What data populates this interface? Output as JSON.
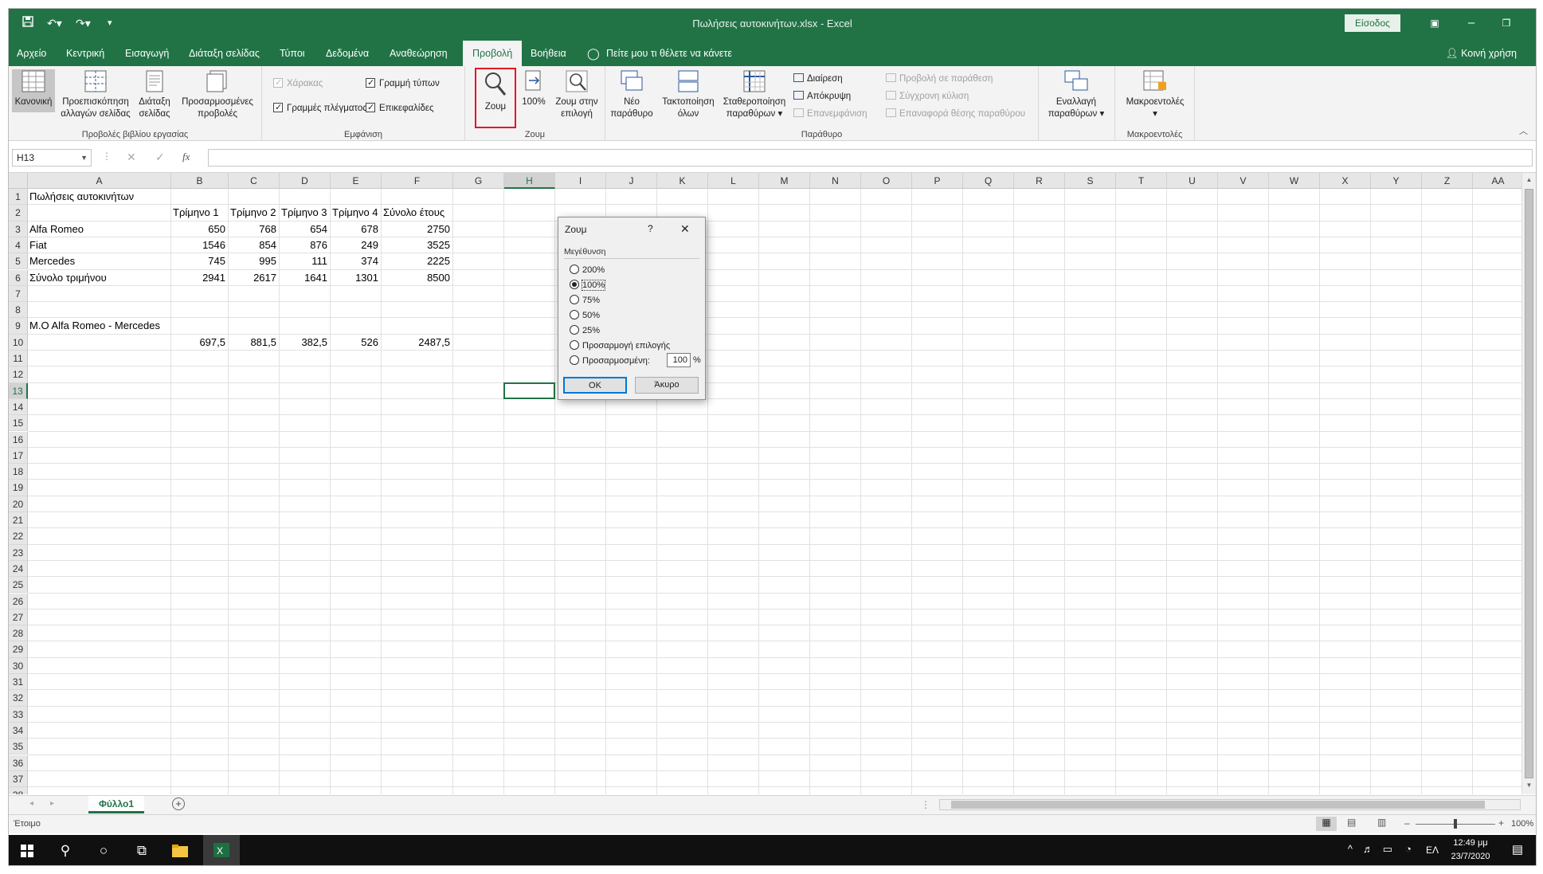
{
  "window": {
    "title": "Πωλήσεις αυτοκινήτων.xlsx  -  Excel",
    "signin_label": "Είσοδος",
    "qat_icons": [
      "save-icon",
      "undo-icon",
      "redo-icon",
      "customize-icon"
    ]
  },
  "tabs": [
    "Αρχείο",
    "Κεντρική",
    "Εισαγωγή",
    "Διάταξη σελίδας",
    "Τύποι",
    "Δεδομένα",
    "Αναθεώρηση",
    "Προβολή",
    "Βοήθεια"
  ],
  "active_tab": "Προβολή",
  "tell_me": "Πείτε μου τι θέλετε να κάνετε",
  "share_label": "Κοινή χρήση",
  "ribbon": {
    "views_group": {
      "label": "Προβολές βιβλίου εργασίας",
      "normal": "Κανονική",
      "page_break_1": "Προεπισκόπηση",
      "page_break_2": "αλλαγών σελίδας",
      "page_layout_1": "Διάταξη",
      "page_layout_2": "σελίδας",
      "custom_1": "Προσαρμοσμένες",
      "custom_2": "προβολές"
    },
    "show_group": {
      "label": "Εμφάνιση",
      "ruler": "Χάρακας",
      "formula_bar": "Γραμμή τύπων",
      "gridlines": "Γραμμές πλέγματος",
      "headings": "Επικεφαλίδες"
    },
    "zoom_group": {
      "label": "Ζουμ",
      "zoom": "Ζουμ",
      "hundred": "100%",
      "zoom_sel_1": "Ζουμ στην",
      "zoom_sel_2": "επιλογή"
    },
    "window_group": {
      "label": "Παράθυρο",
      "new_window_1": "Νέο",
      "new_window_2": "παράθυρο",
      "arrange_1": "Τακτοποίηση",
      "arrange_2": "όλων",
      "freeze_1": "Σταθεροποίηση",
      "freeze_2": "παραθύρων ▾",
      "split": "Διαίρεση",
      "hide": "Απόκρυψη",
      "unhide": "Επανεμφάνιση",
      "side_by_side": "Προβολή σε παράθεση",
      "sync_scroll": "Σύγχρονη κύλιση",
      "reset_pos": "Επαναφορά θέσης παραθύρου",
      "switch_1": "Εναλλαγή",
      "switch_2": "παραθύρων ▾"
    },
    "macros_group": {
      "label": "Μακροεντολές",
      "macros_1": "Μακροεντολές",
      "macros_2": "▾"
    }
  },
  "formula_bar": {
    "name_box": "H13",
    "fx": "fx",
    "formula": ""
  },
  "sheet": {
    "columns": [
      "A",
      "B",
      "C",
      "D",
      "E",
      "F",
      "G",
      "H",
      "I",
      "J",
      "K",
      "L",
      "M",
      "N",
      "O",
      "P",
      "Q",
      "R",
      "S",
      "T",
      "U",
      "V",
      "W",
      "X",
      "Y",
      "Z",
      "AA"
    ],
    "rows": [
      "1",
      "2",
      "3",
      "4",
      "5",
      "6",
      "7",
      "8",
      "9",
      "10",
      "11",
      "12",
      "13",
      "14",
      "15",
      "16",
      "17",
      "18",
      "19",
      "20",
      "21",
      "22",
      "23",
      "24",
      "25",
      "26",
      "27",
      "28",
      "29",
      "30",
      "31",
      "32",
      "33",
      "34",
      "35",
      "36",
      "37",
      "38"
    ],
    "selected_cell": "H13",
    "cells": [
      {
        "ref": "A1",
        "v": "Πωλήσεις αυτοκινήτων"
      },
      {
        "ref": "B2",
        "v": "Τρίμηνο 1"
      },
      {
        "ref": "C2",
        "v": "Τρίμηνο 2"
      },
      {
        "ref": "D2",
        "v": "Τρίμηνο 3"
      },
      {
        "ref": "E2",
        "v": "Τρίμηνο 4"
      },
      {
        "ref": "F2",
        "v": "Σύνολο έτους"
      },
      {
        "ref": "A3",
        "v": "Alfa Romeo"
      },
      {
        "ref": "B3",
        "v": "650",
        "n": 1
      },
      {
        "ref": "C3",
        "v": "768",
        "n": 1
      },
      {
        "ref": "D3",
        "v": "654",
        "n": 1
      },
      {
        "ref": "E3",
        "v": "678",
        "n": 1
      },
      {
        "ref": "F3",
        "v": "2750",
        "n": 1
      },
      {
        "ref": "A4",
        "v": "Fiat"
      },
      {
        "ref": "B4",
        "v": "1546",
        "n": 1
      },
      {
        "ref": "C4",
        "v": "854",
        "n": 1
      },
      {
        "ref": "D4",
        "v": "876",
        "n": 1
      },
      {
        "ref": "E4",
        "v": "249",
        "n": 1
      },
      {
        "ref": "F4",
        "v": "3525",
        "n": 1
      },
      {
        "ref": "A5",
        "v": "Mercedes"
      },
      {
        "ref": "B5",
        "v": "745",
        "n": 1
      },
      {
        "ref": "C5",
        "v": "995",
        "n": 1
      },
      {
        "ref": "D5",
        "v": "111",
        "n": 1
      },
      {
        "ref": "E5",
        "v": "374",
        "n": 1
      },
      {
        "ref": "F5",
        "v": "2225",
        "n": 1
      },
      {
        "ref": "A6",
        "v": "Σύνολο τριμήνου"
      },
      {
        "ref": "B6",
        "v": "2941",
        "n": 1
      },
      {
        "ref": "C6",
        "v": "2617",
        "n": 1
      },
      {
        "ref": "D6",
        "v": "1641",
        "n": 1
      },
      {
        "ref": "E6",
        "v": "1301",
        "n": 1
      },
      {
        "ref": "F6",
        "v": "8500",
        "n": 1
      },
      {
        "ref": "A9",
        "v": "M.O Alfa Romeo - Mercedes"
      },
      {
        "ref": "B10",
        "v": "697,5",
        "n": 1
      },
      {
        "ref": "C10",
        "v": "881,5",
        "n": 1
      },
      {
        "ref": "D10",
        "v": "382,5",
        "n": 1
      },
      {
        "ref": "E10",
        "v": "526",
        "n": 1
      },
      {
        "ref": "F10",
        "v": "2487,5",
        "n": 1
      }
    ],
    "tab_name": "Φύλλο1"
  },
  "status": {
    "ready": "Έτοιμο",
    "zoom": "100%",
    "zoom_level_percent": 100
  },
  "dialog": {
    "title": "Ζουμ",
    "help": "?",
    "close": "✕",
    "section": "Μεγέθυνση",
    "options": [
      "200%",
      "100%",
      "75%",
      "50%",
      "25%",
      "Προσαρμογή επιλογής",
      "Προσαρμοσμένη:"
    ],
    "selected_option": "100%",
    "custom_value": "100",
    "custom_unit": "%",
    "ok": "OK",
    "cancel": "Άκυρο"
  },
  "taskbar": {
    "time": "12:49 μμ",
    "date": "23/7/2020",
    "lang": "ΕΛ"
  },
  "colors": {
    "excel_green": "#217346",
    "highlight_red": "#e81123"
  }
}
